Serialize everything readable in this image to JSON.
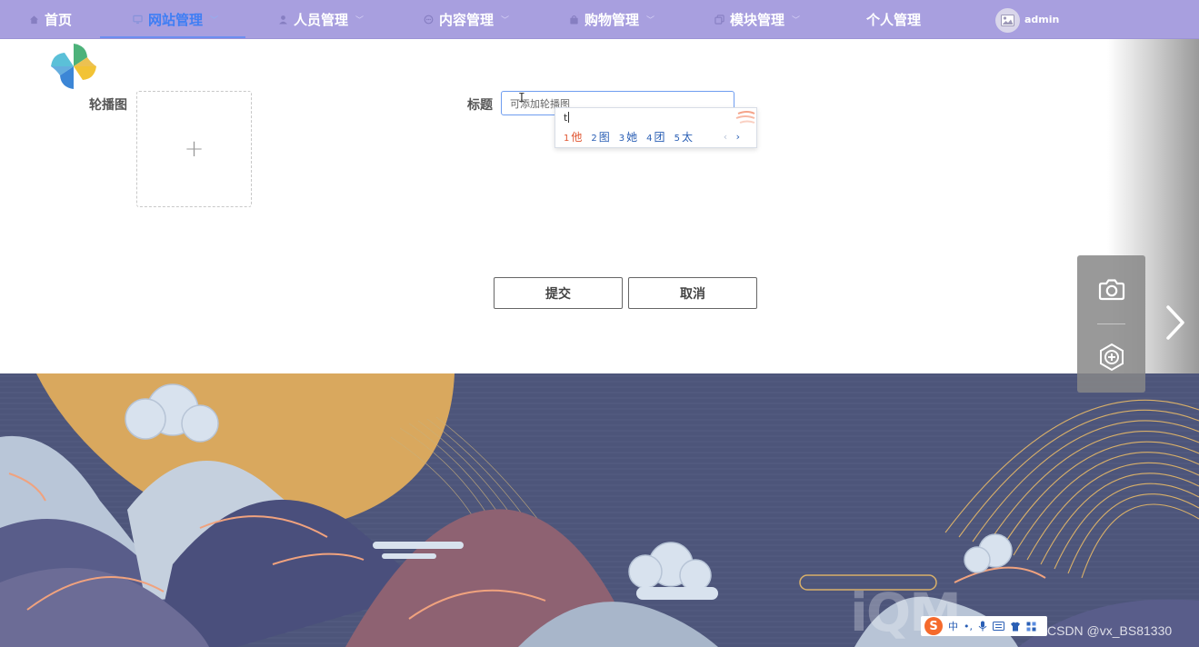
{
  "nav": {
    "items": [
      {
        "label": "首页",
        "icon": "home-icon"
      },
      {
        "label": "网站管理",
        "icon": "monitor-icon",
        "active": true
      },
      {
        "label": "人员管理",
        "icon": "user-icon"
      },
      {
        "label": "内容管理",
        "icon": "chat-icon"
      },
      {
        "label": "购物管理",
        "icon": "bag-icon"
      },
      {
        "label": "模块管理",
        "icon": "copy-icon"
      },
      {
        "label": "个人管理",
        "icon": ""
      }
    ],
    "user": "admin",
    "colors": {
      "bar": "#a89fdf",
      "active": "#3f7ef4"
    }
  },
  "form": {
    "carousel_label": "轮播图",
    "upload_plus": "+",
    "title_label": "标题",
    "title_value": "可添加轮播图",
    "submit": "提交",
    "cancel": "取消"
  },
  "ime": {
    "composition": "t",
    "candidates": [
      {
        "num": "1",
        "text": "他"
      },
      {
        "num": "2",
        "text": "图"
      },
      {
        "num": "3",
        "text": "她"
      },
      {
        "num": "4",
        "text": "团"
      },
      {
        "num": "5",
        "text": "太"
      }
    ],
    "prev": "‹",
    "next": "›",
    "toolbar": {
      "logo": "S",
      "mode": "中",
      "punct": "•,"
    }
  },
  "overlay": {
    "watermark": "iQM",
    "credit": "CSDN @vx_BS81330"
  }
}
